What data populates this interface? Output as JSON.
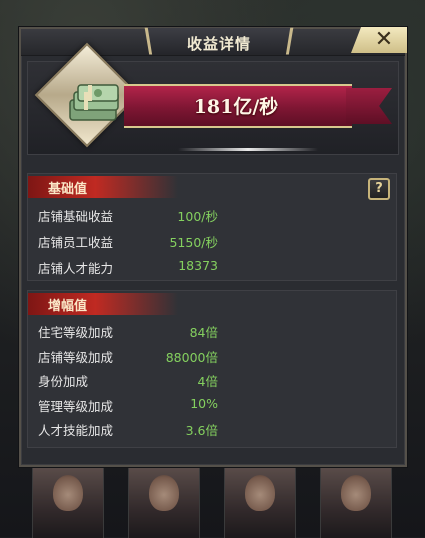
{
  "dialog": {
    "title": "收益详情",
    "close_label": "✕"
  },
  "income": {
    "rate": "181亿/秒"
  },
  "base_section": {
    "title": "基础值",
    "help_label": "?",
    "rows": [
      {
        "label": "店铺基础收益",
        "value": "100/秒"
      },
      {
        "label": "店铺员工收益",
        "value": "5150/秒"
      },
      {
        "label": "店铺人才能力",
        "value": "18373"
      }
    ]
  },
  "boost_section": {
    "title": "增幅值",
    "rows": [
      {
        "label": "住宅等级加成",
        "value": "84倍"
      },
      {
        "label": "店铺等级加成",
        "value": "88000倍"
      },
      {
        "label": "身份加成",
        "value": "4倍"
      },
      {
        "label": "管理等级加成",
        "value": "10%"
      },
      {
        "label": "人才技能加成",
        "value": "3.6倍"
      }
    ]
  },
  "colors": {
    "value_green": "#84d05f",
    "ribbon_red": "#7e1633",
    "section_header_red": "#c02a22",
    "gold_trim": "#d8c98e"
  }
}
